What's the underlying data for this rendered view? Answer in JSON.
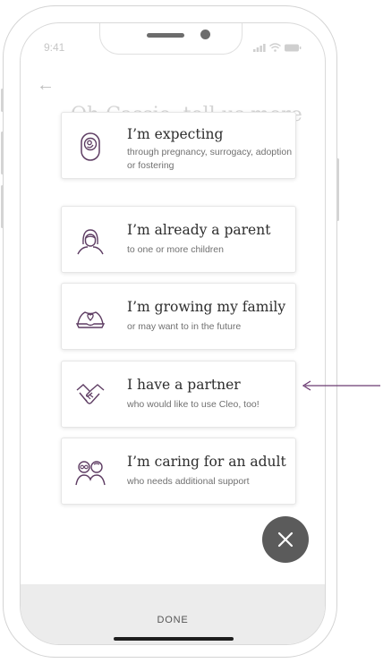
{
  "status_bar": {
    "time": "9:41"
  },
  "background_heading": "Oh Cassie, tell us more",
  "options": [
    {
      "title": "I’m expecting",
      "subtitle": "through pregnancy, surrogacy, adoption or fostering",
      "icon": "pregnancy-icon"
    },
    {
      "title": "I’m already a parent",
      "subtitle": "to one or more children",
      "icon": "parent-icon"
    },
    {
      "title": "I’m growing my family",
      "subtitle": "or may want to in the future",
      "icon": "growing-family-icon"
    },
    {
      "title": "I have a partner",
      "subtitle": "who would like to use Cleo, too!",
      "icon": "handshake-icon"
    },
    {
      "title": "I’m caring for an adult",
      "subtitle": "who needs additional support",
      "icon": "caregiver-icon"
    }
  ],
  "footer": {
    "done_label": "DONE"
  },
  "colors": {
    "icon_accent": "#5e3d63",
    "fab": "#5b5b5b",
    "footer_bg": "#ececec",
    "pointer_arrow": "#6b3a72"
  }
}
